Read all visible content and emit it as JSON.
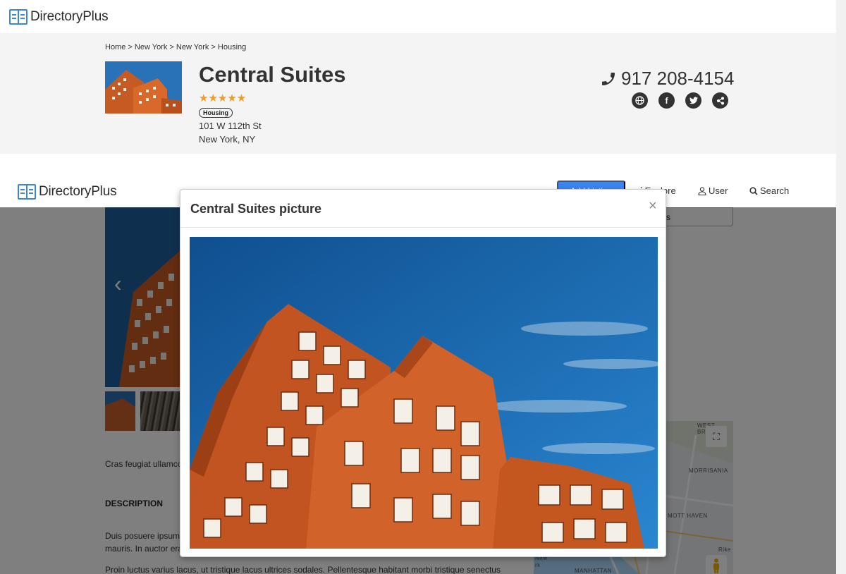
{
  "brand": {
    "name": "DirectoryPlus",
    "accent": "#3b86d8"
  },
  "breadcrumb": [
    "Home",
    "New York",
    "New York",
    "Housing"
  ],
  "breadcrumb_text": "Home > New York > New York > Housing",
  "listing": {
    "title": "Central Suites",
    "rating": 5,
    "stars": "★★★★★",
    "category": "Housing",
    "address_line1": "101 W 112th St",
    "address_line2": "New York, NY",
    "phone": "917 208-4154",
    "phone_icon": "phone-icon",
    "social_icons": [
      "globe-icon",
      "facebook-icon",
      "twitter-icon",
      "share-icon"
    ]
  },
  "nav": {
    "add_button": "Add Listing",
    "explore": "Explore",
    "user": "User",
    "search": "Search"
  },
  "body": {
    "excerpt": "Cras feugiat ullamco",
    "description_heading": "DESCRIPTION",
    "description_p1_line1": "Duis posuere ipsum",
    "description_p1_line2": "mauris. In auctor era",
    "description_p2": "Proin luctus varius lacus, ut tristique lacus ultrices sodales. Pellentesque habitant morbi tristique senectus",
    "side_button": "s"
  },
  "map": {
    "labels": [
      "WEST BRONX",
      "MORRISANIA",
      "MOTT HAVEN",
      "MANHATTAN",
      "Rike",
      "New",
      "rk"
    ]
  },
  "modal": {
    "title": "Central Suites picture",
    "close": "×"
  },
  "colors": {
    "star": "#f39a26",
    "button_blue": "#3b86f0",
    "building_orange": "#c9602a",
    "sky": "#1c5fa3"
  }
}
